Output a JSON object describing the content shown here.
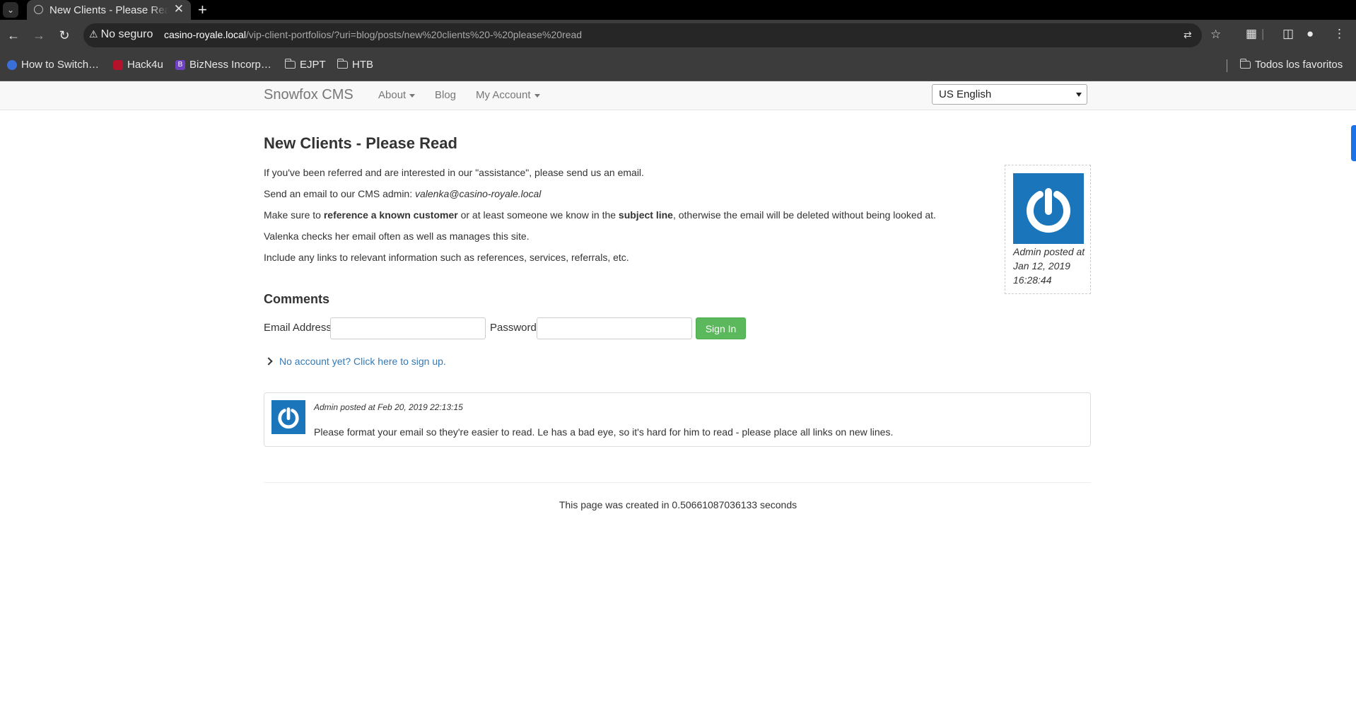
{
  "browser": {
    "tab_title": "New Clients - Please Read",
    "tab_close": "✕",
    "new_tab": "+",
    "security_label": "No seguro",
    "url_host": "casino-royale.local",
    "url_path": "/vip-client-portfolios/?uri=blog/posts/new%20clients%20-%20please%20read",
    "bookmarks": [
      {
        "label": "How to Switch…",
        "icon": "shield-icon",
        "color": "#3b6fd8"
      },
      {
        "label": "Hack4u",
        "icon": "hack4u-icon",
        "color": "#b3122b"
      },
      {
        "label": "BizNess Incorp…",
        "icon": "bootstrap-icon",
        "color": "#6f42c1",
        "letter": "B"
      },
      {
        "label": "EJPT",
        "icon": "folder-icon"
      },
      {
        "label": "HTB",
        "icon": "folder-icon"
      }
    ],
    "all_bookmarks": "Todos los favoritos"
  },
  "site": {
    "brand": "Snowfox CMS",
    "nav": {
      "about": "About",
      "blog": "Blog",
      "account": "My Account"
    },
    "language": "US English"
  },
  "post": {
    "title": "New Clients - Please Read",
    "p1": "If you've been referred and are interested in our \"assistance\", please send us an email.",
    "p2_prefix": "Send an email to our CMS admin: ",
    "p2_email": "valenka@casino-royale.local",
    "p3_a": "Make sure to ",
    "p3_b": "reference a known customer",
    "p3_c": " or at least someone we know in the ",
    "p3_d": "subject line",
    "p3_e": ", otherwise the email will be deleted without being looked at.",
    "p4": "Valenka checks her email often as well as manages this site.",
    "p5": "Include any links to relevant information such as references, services, referrals, etc.",
    "author_caption": "Admin posted at Jan 12, 2019 16:28:44"
  },
  "comments": {
    "title": "Comments",
    "email_label": "Email Address",
    "password_label": "Password",
    "signin": "Sign In",
    "signup": "No account yet? Click here to sign up.",
    "items": [
      {
        "meta": "Admin posted at Feb 20, 2019 22:13:15",
        "body": "Please format your email so they're easier to read. Le has a bad eye, so it's hard for him to read - please place all links on new lines."
      }
    ]
  },
  "footer": {
    "text": "This page was created in 0.50661087036133 seconds"
  },
  "colors": {
    "avatar": "#1a75bb",
    "signin": "#5cb85c",
    "link": "#337ab7"
  }
}
